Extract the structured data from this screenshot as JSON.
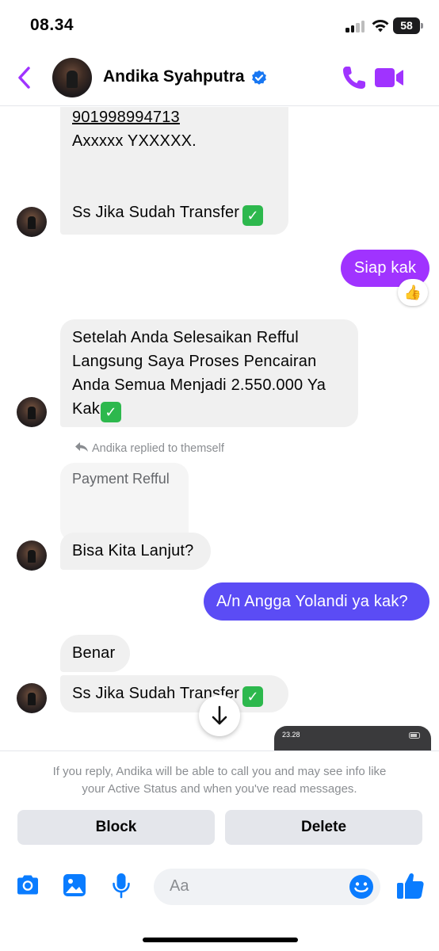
{
  "status_bar": {
    "time": "08.34",
    "battery": "58"
  },
  "header": {
    "contact_name": "Andika Syahputra"
  },
  "messages": {
    "top_account": "901998994713",
    "top_name": "Axxxxx YXXXXX.",
    "top_ss": "Ss Jika Sudah Transfer",
    "reply_siap": "Siap kak",
    "reaction": "👍",
    "setelah_lines": [
      "Setelah Anda Selesaikan Refful",
      "Langsung Saya Proses Pencairan",
      "Anda Semua Menjadi 2.550.000 Ya",
      "Kak"
    ],
    "replied_note": "Andika replied to themself",
    "quoted_text": "Payment Refful",
    "bisa": "Bisa Kita Lanjut?",
    "an": "A/n Angga Yolandi ya kak?",
    "benar": "Benar",
    "bottom_ss": "Ss Jika Sudah Transfer",
    "thumb_time": "23.28"
  },
  "notice": {
    "line1": "If you reply, Andika will be able to call you and may see info like",
    "line2": "your Active Status and when you've read messages."
  },
  "actions": {
    "block": "Block",
    "delete": "Delete"
  },
  "composer": {
    "placeholder": "Aa"
  },
  "colors": {
    "accent_purple": "#a033ff",
    "accent_blue": "#5b4cf5",
    "icon_blue": "#0a7cff",
    "verified_blue": "#1877f2"
  }
}
